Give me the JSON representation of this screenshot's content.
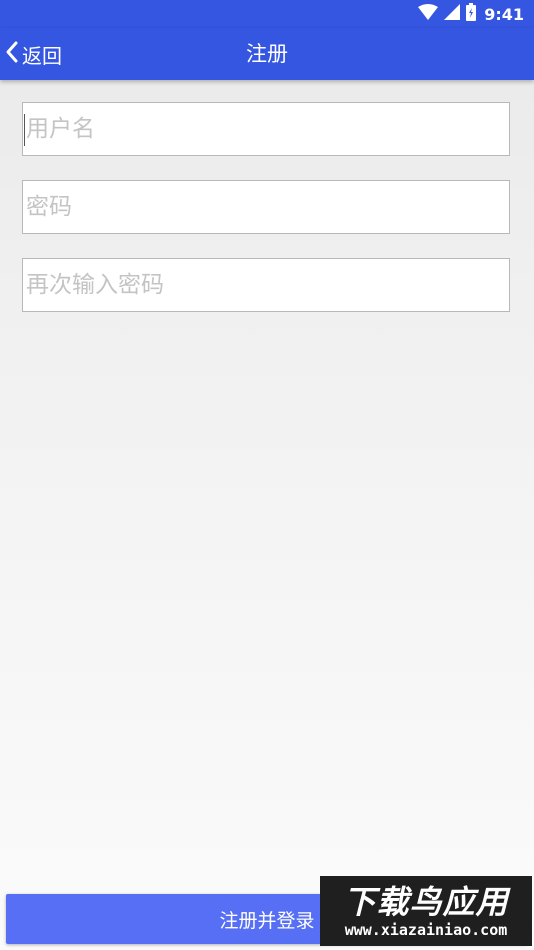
{
  "status_bar": {
    "time": "9:41",
    "icons": [
      "wifi-icon",
      "cell-signal-icon",
      "battery-icon"
    ],
    "color": "#3556e0"
  },
  "app_bar": {
    "back_label": "返回",
    "title": "注册",
    "color": "#3556e0"
  },
  "form": {
    "username_placeholder": "用户名",
    "username_value": "",
    "password_placeholder": "密码",
    "password_value": "",
    "confirm_password_placeholder": "再次输入密码",
    "confirm_password_value": ""
  },
  "submit_button": {
    "label": "注册并登录",
    "color": "#566ff5"
  },
  "watermark": {
    "title": "下载鸟应用",
    "url": "www.xiazainiao.com"
  }
}
